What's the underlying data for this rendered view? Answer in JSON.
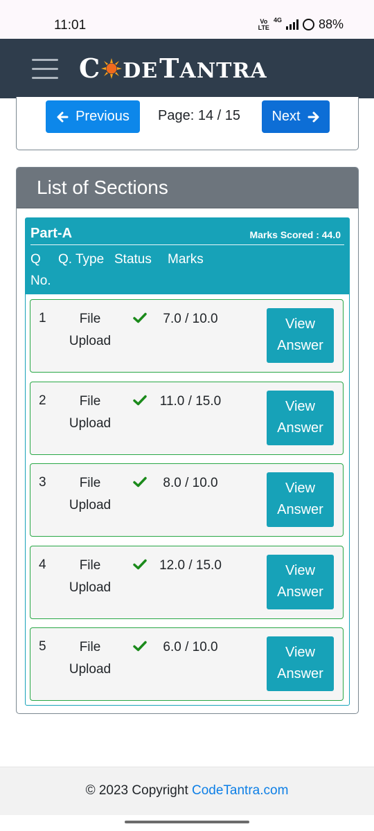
{
  "status_bar": {
    "time": "11:01",
    "volte_top": "Vo",
    "volte_bottom": "LTE",
    "network": "4G",
    "battery": "88%"
  },
  "navbar": {
    "logo_c": "C",
    "logo_de": "DE",
    "logo_t": "T",
    "logo_antra": "ANTRA"
  },
  "pager": {
    "previous_label": "Previous",
    "page_label": "Page: 14 / 15",
    "next_label": "Next"
  },
  "sections": {
    "title": "List of Sections",
    "part": {
      "name": "Part-A",
      "marks_scored": "Marks Scored : 44.0",
      "columns": {
        "q_no": "Q No.",
        "q_type": "Q. Type",
        "status": "Status",
        "marks": "Marks"
      },
      "rows": [
        {
          "no": "1",
          "type": "File Upload",
          "marks": "7.0 / 10.0",
          "action": "View Answer"
        },
        {
          "no": "2",
          "type": "File Upload",
          "marks": "11.0 / 15.0",
          "action": "View Answer"
        },
        {
          "no": "3",
          "type": "File Upload",
          "marks": "8.0 / 10.0",
          "action": "View Answer"
        },
        {
          "no": "4",
          "type": "File Upload",
          "marks": "12.0 / 15.0",
          "action": "View Answer"
        },
        {
          "no": "5",
          "type": "File Upload",
          "marks": "6.0 / 10.0",
          "action": "View Answer"
        }
      ]
    }
  },
  "footer": {
    "copyright": "© 2023 Copyright ",
    "link": "CodeTantra.com"
  },
  "colors": {
    "navbar": "#2f3d4c",
    "primary": "#0d87ea",
    "info": "#17a2b8",
    "success": "#28a745",
    "section_header": "#6d757d"
  },
  "icons": {
    "prev": "arrow-left-icon",
    "next": "arrow-right-icon",
    "status": "check-icon",
    "menu": "hamburger-menu-icon",
    "logo_sun": "sun-icon"
  }
}
